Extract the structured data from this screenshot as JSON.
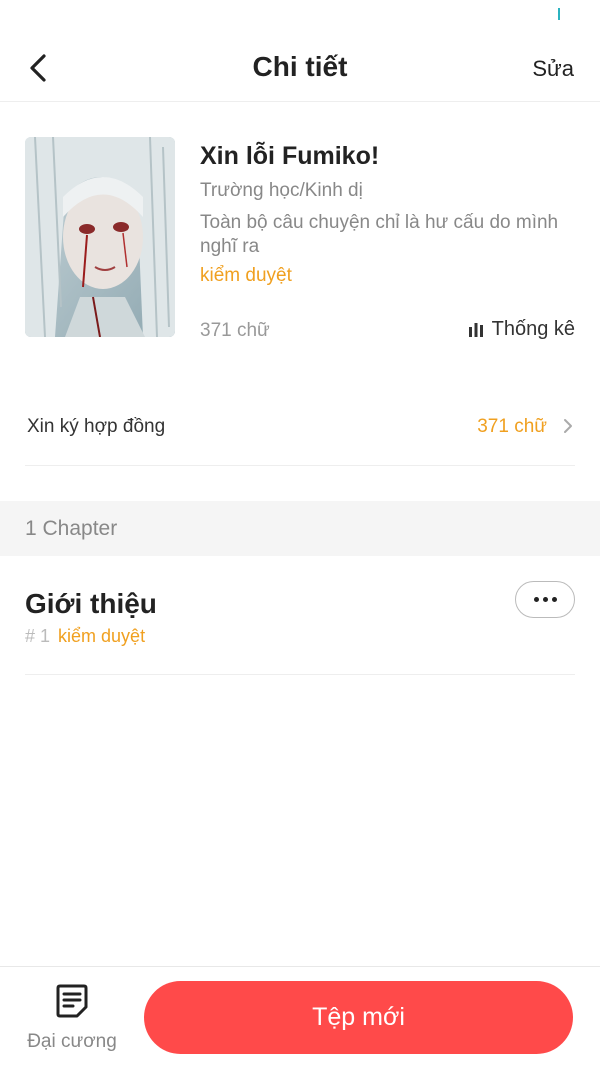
{
  "nav": {
    "title": "Chi tiết",
    "edit_label": "Sửa"
  },
  "book": {
    "title": "Xin lỗi Fumiko!",
    "genre": "Trường học/Kinh dị",
    "description": "Toàn bộ câu chuyện chỉ là hư cấu do mình nghĩ ra",
    "status": "kiểm duyệt",
    "word_count": "371 chữ",
    "stats_label": "Thống kê"
  },
  "contract": {
    "label": "Xin ký hợp đồng",
    "value": "371 chữ"
  },
  "chapters": {
    "header": "1 Chapter",
    "items": [
      {
        "title": "Giới thiệu",
        "number": "# 1",
        "status": "kiểm duyệt"
      }
    ]
  },
  "bottom": {
    "outline_label": "Đại cương",
    "new_file_label": "Tệp mới"
  },
  "colors": {
    "accent": "#ff4a4a",
    "status": "#f0a020"
  },
  "icons": {
    "back": "chevron-left-icon",
    "stats": "bar-chart-icon",
    "contract_arrow": "chevron-right-icon",
    "more": "more-dots-icon",
    "outline": "document-icon"
  }
}
